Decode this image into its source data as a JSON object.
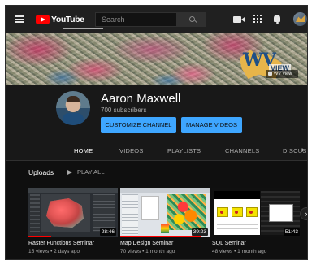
{
  "topbar": {
    "logo_text": "YouTube",
    "search_placeholder": "Search",
    "icons": [
      "menu-icon",
      "search-icon",
      "create-video-icon",
      "apps-icon",
      "notifications-icon",
      "account-avatar"
    ]
  },
  "banner": {
    "logo_letters": "WV",
    "logo_word": "VIEW",
    "link_text": "WV View"
  },
  "channel": {
    "name": "Aaron Maxwell",
    "subscribers": "700 subscribers",
    "customize_label": "CUSTOMIZE CHANNEL",
    "manage_label": "MANAGE VIDEOS"
  },
  "tabs": {
    "home": "HOME",
    "videos": "VIDEOS",
    "playlists": "PLAYLISTS",
    "channels": "CHANNELS",
    "discussion": "DISCUS",
    "active": "HOME"
  },
  "uploads": {
    "title": "Uploads",
    "play_all": "PLAY ALL",
    "videos": [
      {
        "title": "Raster Functions Seminar",
        "meta": "15 views • 2 days ago",
        "duration": "28:46",
        "watched_fraction": 0.25
      },
      {
        "title": "Map Design Seminar",
        "meta": "70 views • 1 month ago",
        "duration": "39:23",
        "watched_fraction": 0.9
      },
      {
        "title": "SQL Seminar",
        "meta": "48 views • 1 month ago",
        "duration": "51:43",
        "watched_fraction": 0.0
      }
    ]
  },
  "colors": {
    "background": "#181818",
    "accent_blue": "#3ea6ff",
    "brand_red": "#ff0000"
  }
}
